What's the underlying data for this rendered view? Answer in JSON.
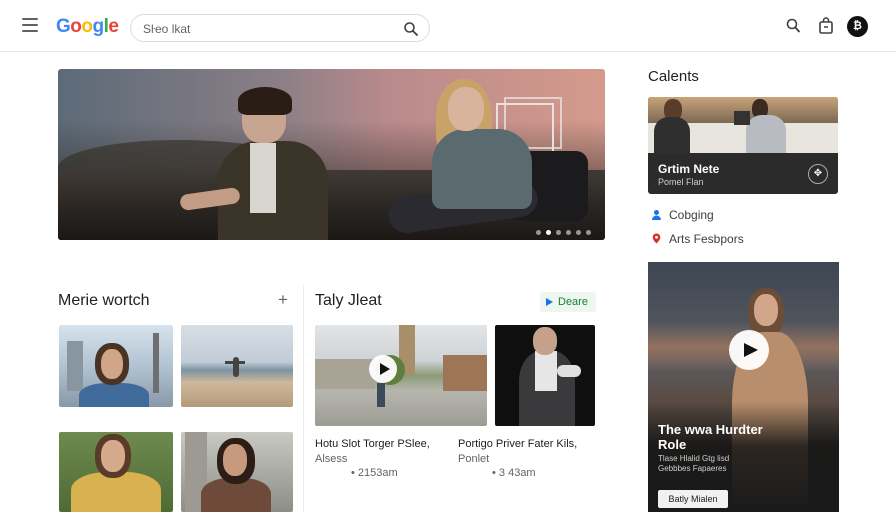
{
  "header": {
    "logo_letters": [
      {
        "char": "G",
        "color": "#4285F4"
      },
      {
        "char": "o",
        "color": "#EA4335"
      },
      {
        "char": "o",
        "color": "#FBBC05"
      },
      {
        "char": "g",
        "color": "#4285F4"
      },
      {
        "char": "l",
        "color": "#34A853"
      },
      {
        "char": "e",
        "color": "#EA4335"
      }
    ],
    "search_placeholder": "Sŀeo lkat",
    "icons": [
      "menu-icon",
      "search-icon",
      "account-icon",
      "shopping-bag-icon"
    ],
    "avatar_letter": "₿"
  },
  "hero": {
    "slide_count": 6,
    "active_slide": 2
  },
  "left_section": {
    "title": "Merie wortch",
    "add_label": "+"
  },
  "middle_section": {
    "title": "Taly Jleat",
    "chip_label": "Deare",
    "videos": [
      {
        "title": "Hotu Slot Torger PSlee,",
        "subtitle": "Alsess",
        "meta": "• 2153am"
      },
      {
        "title": "Portigo Priver Fater Kils,",
        "subtitle": "Ponlet",
        "meta": "• 3 43am"
      }
    ]
  },
  "right_column": {
    "heading": "Calents",
    "card": {
      "title": "Grtim Nete",
      "subtitle": "Pomel Flan"
    },
    "links": [
      {
        "label": "Cobging",
        "icon": "person-icon",
        "color": "#1a73e8"
      },
      {
        "label": "Arts Fesbpors",
        "icon": "pin-icon",
        "color": "#d93025"
      }
    ],
    "feature": {
      "title_line1": "The wwa Hurdter",
      "title_line2": "Role",
      "desc_line1": "Tlase Hlalid Gtg lisd",
      "desc_line2": "Gebbbes Fapaeres",
      "button_label": "Batly Mialen"
    }
  }
}
